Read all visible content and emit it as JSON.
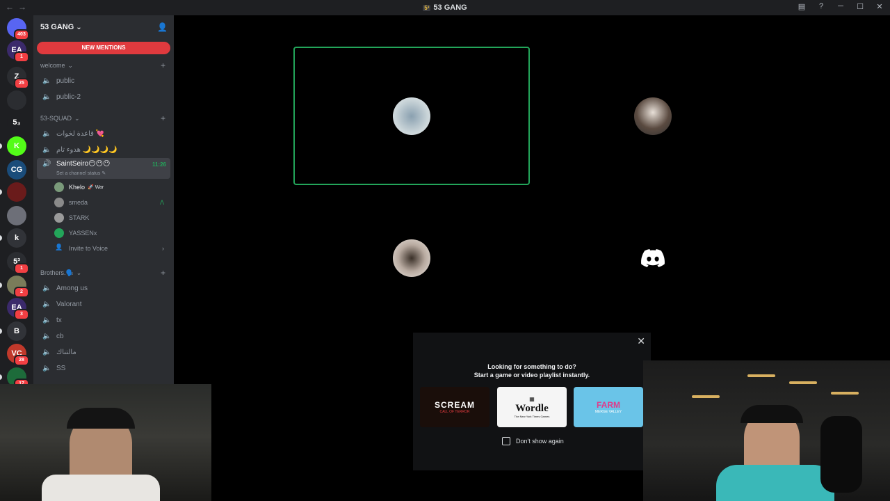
{
  "window": {
    "title": "53 GANG",
    "nav_back": "←",
    "nav_forward": "→",
    "icons": [
      "inbox-icon",
      "help-icon",
      "minimize-icon",
      "maximize-icon",
      "close-icon"
    ],
    "ctrl_min": "─",
    "ctrl_max": "☐",
    "ctrl_close": "✕"
  },
  "servers": [
    {
      "name": "discord-home",
      "label": "",
      "badge": "403",
      "color": "#5865f2"
    },
    {
      "name": "ea",
      "label": "EA",
      "badge": "1",
      "color": "#3b2a6b"
    },
    {
      "name": "z",
      "label": "Z",
      "badge": "25",
      "color": "#2b2d31"
    },
    {
      "name": "arabic",
      "label": "",
      "badge": "",
      "color": "#2b2d31"
    },
    {
      "name": "53",
      "label": "5₃",
      "badge": "",
      "color": "#1e1f22"
    },
    {
      "name": "kick",
      "label": "K",
      "badge": "",
      "color": "#53fc18"
    },
    {
      "name": "cg",
      "label": "CG",
      "badge": "",
      "color": "#1a4c7a"
    },
    {
      "name": "red",
      "label": "",
      "badge": "",
      "color": "#6a1b1b"
    },
    {
      "name": "gray",
      "label": "",
      "badge": "",
      "color": "#6d6f78"
    },
    {
      "name": "k",
      "label": "k",
      "badge": "",
      "color": "#313338"
    },
    {
      "name": "53gang",
      "label": "5³",
      "badge": "1",
      "color": "#2b2d31"
    },
    {
      "name": "pic",
      "label": "",
      "badge": "2",
      "color": "#7a7c5a"
    },
    {
      "name": "ea2",
      "label": "EA",
      "badge": "3",
      "color": "#3b2a6b"
    },
    {
      "name": "b",
      "label": "B",
      "badge": "",
      "color": "#313338"
    },
    {
      "name": "vc",
      "label": "VC",
      "badge": "28",
      "color": "#c0392b"
    },
    {
      "name": "last",
      "label": "",
      "badge": "17",
      "color": "#1d6b3a"
    }
  ],
  "guild": {
    "name": "53 GANG",
    "chevron": "⌄",
    "new_mentions": "NEW MENTIONS"
  },
  "categories": [
    {
      "name": "welcome",
      "channels": [
        "public",
        "public-2"
      ]
    },
    {
      "name": "53-SQUAD",
      "channels": [
        "قاعدة لخوات 💘",
        "هدوء تام 🌙🌙🌙🌙"
      ]
    }
  ],
  "active_channel": {
    "name": "SaintSeiro😶😶😶",
    "time": "11:26",
    "status": "Set a channel status ✎"
  },
  "voice_users": [
    {
      "name": "Khelo",
      "tag": "🚀 War",
      "color": "#7a9a7a"
    },
    {
      "name": "smeda",
      "tag": "",
      "color": "#8a8a8a",
      "extra": "Λ"
    },
    {
      "name": "STARK",
      "tag": "",
      "color": "#9a9a9a"
    },
    {
      "name": "YASSENx",
      "tag": "",
      "color": "#23a55a"
    }
  ],
  "invite_voice": "Invite to Voice",
  "invite_chevron": "›",
  "brothers": {
    "name": "Brothers.🗣️",
    "channels": [
      "Among us",
      "Valorant",
      "tx",
      "cb",
      "مالتناك",
      "SS"
    ]
  },
  "tiles": [
    {
      "name": "tile-1",
      "bg": "#c2c6c1",
      "border": "#23a55a"
    },
    {
      "name": "tile-2",
      "bg": "#c9c5c2",
      "border": ""
    },
    {
      "name": "tile-3",
      "bg": "#d6d1cc",
      "border": ""
    },
    {
      "name": "tile-4",
      "bg": "#43b05c",
      "border": ""
    }
  ],
  "activity": {
    "line1": "Looking for something to do?",
    "line2": "Start a game or video playlist instantly.",
    "close": "✕",
    "games": [
      {
        "name": "scream",
        "title": "SCREAM",
        "sub": "CALL OF TERROR",
        "bg": "#1a0e0a",
        "color": "#ffffff"
      },
      {
        "name": "wordle",
        "title": "Wordle",
        "sub": "The New York Times Games",
        "bg": "#f5f5f5",
        "color": "#111111"
      },
      {
        "name": "farm",
        "title": "FARM",
        "sub": "MERGE VALLEY",
        "bg": "#6ac4e8",
        "color": "#e03a8a"
      }
    ],
    "dont_show": "Don't show again"
  }
}
